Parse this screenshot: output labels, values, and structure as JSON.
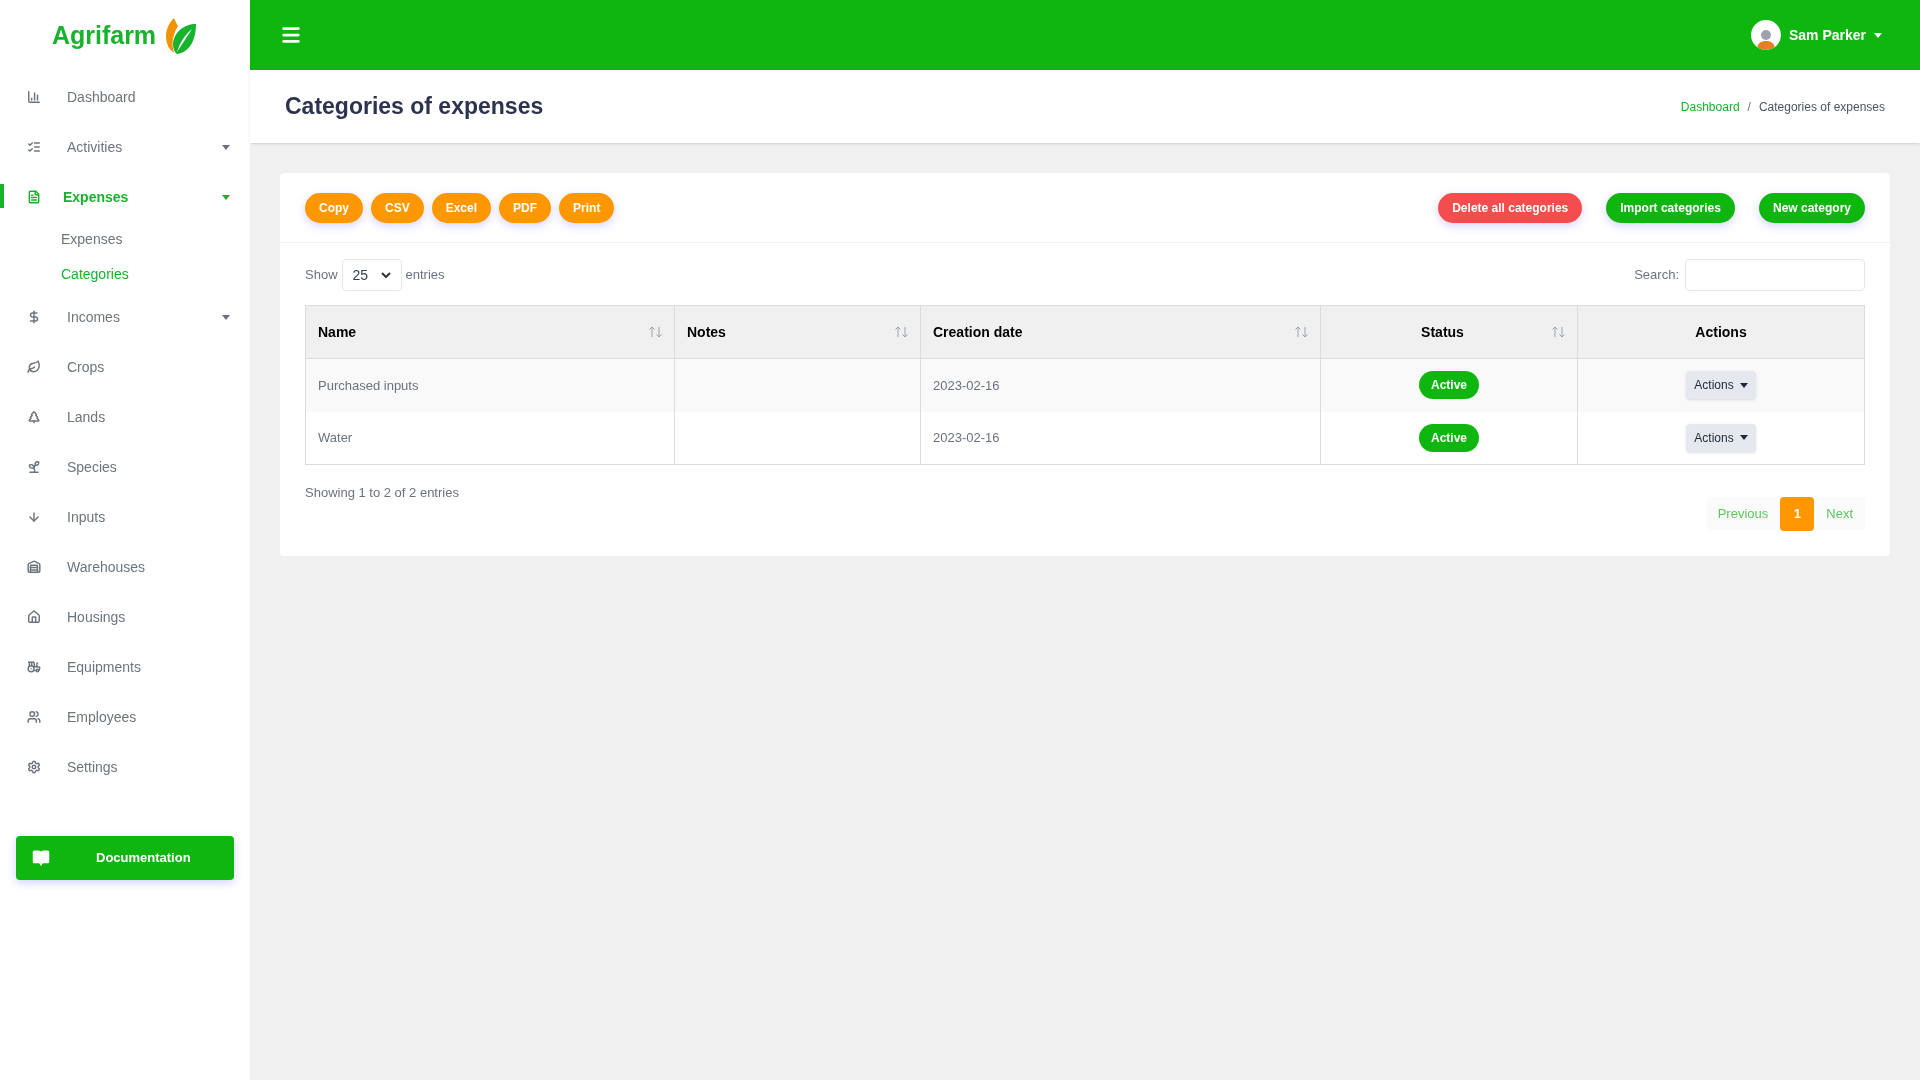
{
  "brand": {
    "name": "Agrifarm"
  },
  "sidebar": {
    "items": [
      {
        "label": "Dashboard",
        "selected": false
      },
      {
        "label": "Activities",
        "selected": false,
        "expanded": false
      },
      {
        "label": "Expenses",
        "selected": true,
        "expanded": true,
        "children": [
          {
            "label": "Expenses",
            "selected": false
          },
          {
            "label": "Categories",
            "selected": true
          }
        ]
      },
      {
        "label": "Incomes",
        "selected": false,
        "expanded": false
      },
      {
        "label": "Crops",
        "selected": false
      },
      {
        "label": "Lands",
        "selected": false
      },
      {
        "label": "Species",
        "selected": false
      },
      {
        "label": "Inputs",
        "selected": false
      },
      {
        "label": "Warehouses",
        "selected": false
      },
      {
        "label": "Housings",
        "selected": false
      },
      {
        "label": "Equipments",
        "selected": false
      },
      {
        "label": "Employees",
        "selected": false
      },
      {
        "label": "Settings",
        "selected": false
      }
    ],
    "documentation_button": "Documentation"
  },
  "topbar": {
    "user": "Sam Parker"
  },
  "page": {
    "title": "Categories of expenses",
    "breadcrumb": [
      {
        "label": "Dashboard",
        "kind": "link"
      },
      {
        "label": "/",
        "kind": "separator"
      },
      {
        "label": "Categories of expenses",
        "kind": "current"
      }
    ]
  },
  "export_buttons": [
    "Copy",
    "CSV",
    "Excel",
    "PDF",
    "Print"
  ],
  "action_buttons": [
    {
      "label": "Delete all categories",
      "kind": "danger"
    },
    {
      "label": "Import categories",
      "kind": "primary"
    },
    {
      "label": "New category",
      "kind": "primary"
    }
  ],
  "length_control": {
    "before": "Show",
    "value": "25",
    "after": "entries"
  },
  "search": {
    "label": "Search:"
  },
  "table": {
    "columns": [
      {
        "label": "Name",
        "sortable": true
      },
      {
        "label": "Notes",
        "sortable": true
      },
      {
        "label": "Creation date",
        "sortable": true
      },
      {
        "label": "Status",
        "sortable": true
      },
      {
        "label": "Actions",
        "sortable": false
      }
    ],
    "rows": [
      {
        "name": "Purchased inputs",
        "creation_date": "2023-02-16",
        "status": "Active",
        "actions": "Actions"
      },
      {
        "name": "Water",
        "creation_date": "2023-02-16",
        "status": "Active",
        "actions": "Actions"
      }
    ]
  },
  "info": "Showing 1 to 2 of 2 entries",
  "pagination": {
    "previous": "Previous",
    "pages": [
      {
        "label": "1",
        "selected": true
      }
    ],
    "next": "Next"
  }
}
